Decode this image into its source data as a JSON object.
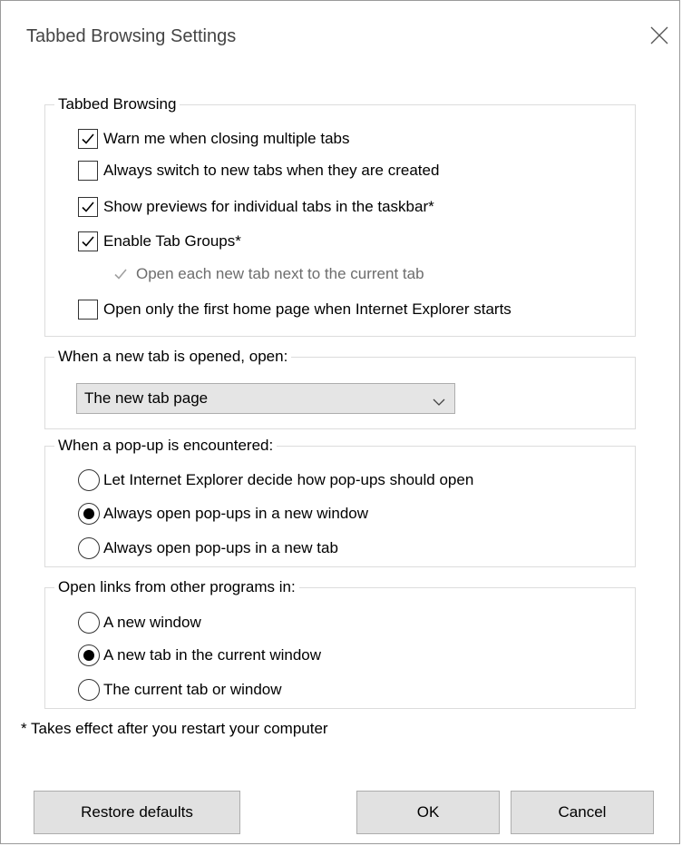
{
  "window": {
    "title": "Tabbed Browsing Settings",
    "close_icon": "close-icon"
  },
  "tabbed_browsing": {
    "legend": "Tabbed Browsing",
    "options": [
      {
        "label": "Warn me when closing multiple tabs",
        "checked": true,
        "enabled": true
      },
      {
        "label": "Always switch to new tabs when they are created",
        "checked": false,
        "enabled": true
      },
      {
        "label": "Show previews for individual tabs in the taskbar*",
        "checked": true,
        "enabled": true
      },
      {
        "label": "Enable Tab Groups*",
        "checked": true,
        "enabled": true
      },
      {
        "label": "Open each new tab next to the current tab",
        "checked": true,
        "enabled": false
      },
      {
        "label": "Open only the first home page when Internet Explorer starts",
        "checked": false,
        "enabled": true
      }
    ]
  },
  "new_tab": {
    "legend": "When a new tab is opened, open:",
    "selected": "The new tab page"
  },
  "popup": {
    "legend": "When a pop-up is encountered:",
    "options": [
      {
        "label": "Let Internet Explorer decide how pop-ups should open",
        "selected": false
      },
      {
        "label": "Always open pop-ups in a new window",
        "selected": true
      },
      {
        "label": "Always open pop-ups in a new tab",
        "selected": false
      }
    ]
  },
  "links": {
    "legend": "Open links from other programs in:",
    "options": [
      {
        "label": "A new window",
        "selected": false
      },
      {
        "label": "A new tab in the current window",
        "selected": true
      },
      {
        "label": "The current tab or window",
        "selected": false
      }
    ]
  },
  "footnote": "* Takes effect after you restart your computer",
  "buttons": {
    "restore": "Restore defaults",
    "ok": "OK",
    "cancel": "Cancel"
  },
  "colors": {
    "button_bg": "#e1e1e1",
    "select_bg": "#e5e5e5",
    "group_border": "#dcdcdc",
    "disabled_text": "#6d6d6d"
  }
}
